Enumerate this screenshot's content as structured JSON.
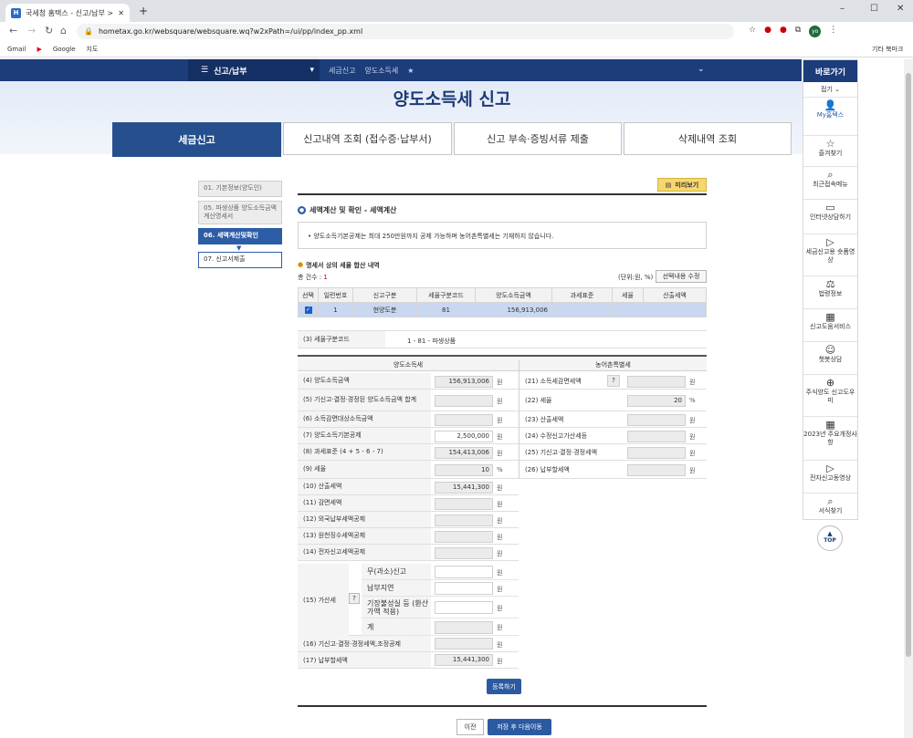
{
  "browser": {
    "tab_title": "국세청 홈택스 - 신고/납부 > 세",
    "url": "hometax.go.kr/websquare/websquare.wq?w2xPath=/ui/pp/index_pp.xml",
    "bookmarks": [
      "Gmail",
      "Google",
      "지도"
    ],
    "other_bookmarks": "기타 북마크",
    "profile": "yo"
  },
  "gnb": {
    "menu": "신고/납부",
    "crumb1": "세금신고",
    "crumb2": "양도소득세"
  },
  "sidebar": {
    "title": "바로가기",
    "collapse": "접기",
    "items": [
      "My홈택스",
      "즐겨찾기",
      "최근접속메뉴",
      "인터넷상담하기",
      "세금신고용 숏폼영상",
      "법령정보",
      "신고도움서비스",
      "챗봇상담",
      "주식양도 신고도우미",
      "2023년 주요개정사항",
      "전자신고동영상",
      "서식찾기"
    ],
    "top": "TOP"
  },
  "page": {
    "title": "양도소득세 신고",
    "tabs": [
      "세금신고",
      "신고내역 조회 (접수증·납부서)",
      "신고 부속·증빙서류 제출",
      "삭제내역 조회"
    ],
    "steps": [
      "01. 기본정보(양도인)",
      "05. 파생상품 양도소득금액 계산명세서",
      "06. 세액계산및확인",
      "07. 신고서제출"
    ],
    "preview": "미리보기",
    "section": "세액계산 및 확인 - 세액계산",
    "notice": "양도소득기본공제는 최대 250만원까지 공제 가능하며 농어촌특별세는 기재하지 않습니다.",
    "subsection": "명세서 상의 세율 합산 내역",
    "count_label": "총 건수 : ",
    "count": "1",
    "unit": "(단위:원, %)",
    "edit_btn": "선택내용 수정",
    "table": {
      "headers": [
        "선택",
        "일련번호",
        "신고구분",
        "세율구분코드",
        "양도소득금액",
        "과세표준",
        "세율",
        "산출세액"
      ],
      "row": [
        "1",
        "현양도분",
        "81",
        "156,913,006",
        "",
        "",
        ""
      ]
    },
    "code_label": "(3) 세율구분코드",
    "code_value": "1 - 81 - 파생상품",
    "left_header": "양도소득세",
    "right_header": "농어촌특별세",
    "won": "원",
    "pct": "%",
    "help": "?",
    "left": [
      {
        "label": "(4) 양도소득금액",
        "value": "156,913,006"
      },
      {
        "label": "(5) 기신고·결정·경정된 양도소득금액 합계",
        "value": ""
      },
      {
        "label": "(6) 소득감면대상소득금액",
        "value": ""
      },
      {
        "label": "(7) 양도소득기본공제",
        "value": "2,500,000"
      },
      {
        "label": "(8) 과세표준 (4 + 5 - 6 - 7)",
        "value": "154,413,006"
      },
      {
        "label": "(9) 세율",
        "value": "10"
      },
      {
        "label": "(10) 산출세액",
        "value": "15,441,300"
      },
      {
        "label": "(11) 감면세액",
        "value": ""
      },
      {
        "label": "(12) 외국납부세액공제",
        "value": ""
      },
      {
        "label": "(13) 원천징수세액공제",
        "value": ""
      },
      {
        "label": "(14) 전자신고세액공제",
        "value": ""
      }
    ],
    "right": [
      {
        "label": "(21) 소득세감면세액",
        "value": ""
      },
      {
        "label": "(22) 세율",
        "value": "20"
      },
      {
        "label": "(23) 산출세액",
        "value": ""
      },
      {
        "label": "(24) 수정신고가산세등",
        "value": ""
      },
      {
        "label": "(25) 기신고·결정·경정세액",
        "value": ""
      },
      {
        "label": "(26) 납부할세액",
        "value": ""
      }
    ],
    "penalty_label": "(15) 가산세",
    "penalty_rows": [
      "무(과소)신고",
      "납부지연",
      "기장불성실 등 (환산가액 적용)",
      "계"
    ],
    "row16": {
      "label": "(16) 기신고·결정·경정세액,조정공제",
      "value": ""
    },
    "row17": {
      "label": "(17) 납부할세액",
      "value": "15,441,300"
    },
    "register": "등록하기",
    "prev": "이전",
    "next": "저장 후 다음이동"
  }
}
